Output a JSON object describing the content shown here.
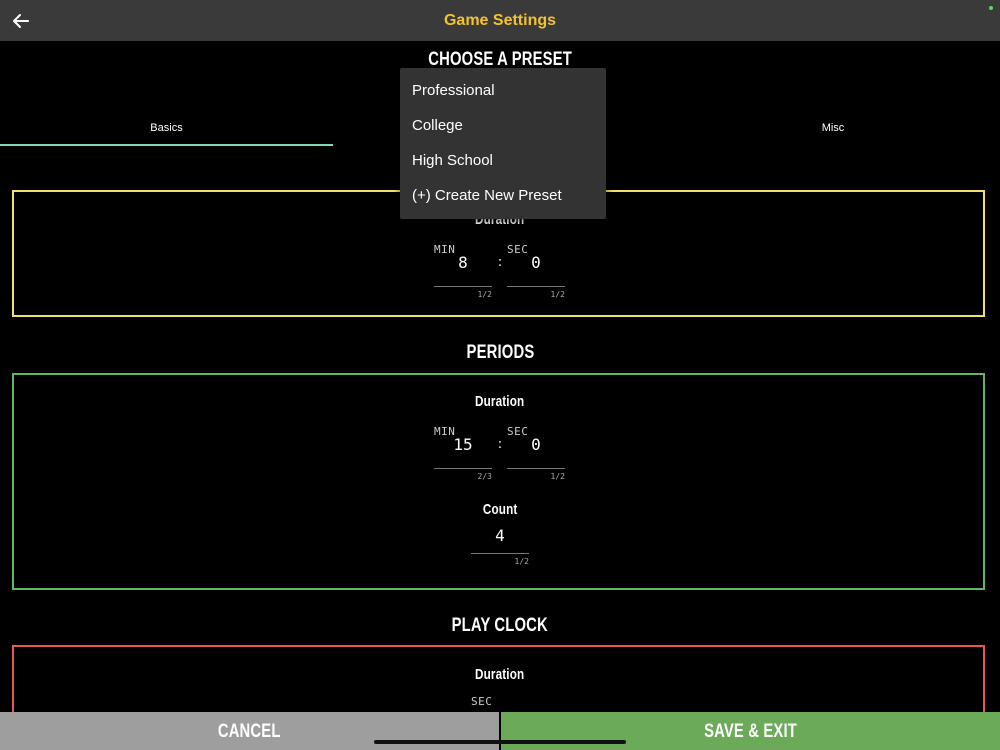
{
  "header": {
    "title": "Game Settings",
    "back_icon": "arrow-left-icon",
    "title_color": "#f1c232"
  },
  "preset": {
    "title": "CHOOSE A PRESET",
    "menu": [
      "Professional",
      "College",
      "High School",
      "(+) Create New Preset"
    ]
  },
  "tabs": [
    {
      "label": "Basics",
      "active": true
    },
    {
      "label": "Misc",
      "active": false
    }
  ],
  "overtime": {
    "duration_label": "Duration",
    "min_unit": "MIN",
    "min_value": "8",
    "min_hint": "1/2",
    "sec_unit": "SEC",
    "sec_value": "0",
    "sec_hint": "1/2",
    "border_color": "#f0e070"
  },
  "periods": {
    "title": "PERIODS",
    "duration_label": "Duration",
    "min_unit": "MIN",
    "min_value": "15",
    "min_hint": "2/3",
    "sec_unit": "SEC",
    "sec_value": "0",
    "sec_hint": "1/2",
    "count_label": "Count",
    "count_value": "4",
    "count_hint": "1/2",
    "border_color": "#62b562"
  },
  "play_clock": {
    "title": "PLAY CLOCK",
    "duration_label": "Duration",
    "sec_unit": "SEC",
    "border_color": "#e55a4e"
  },
  "bottom": {
    "cancel_label": "CANCEL",
    "save_label": "SAVE & EXIT",
    "cancel_color": "#9e9e9e",
    "save_color": "#6aaa59"
  }
}
